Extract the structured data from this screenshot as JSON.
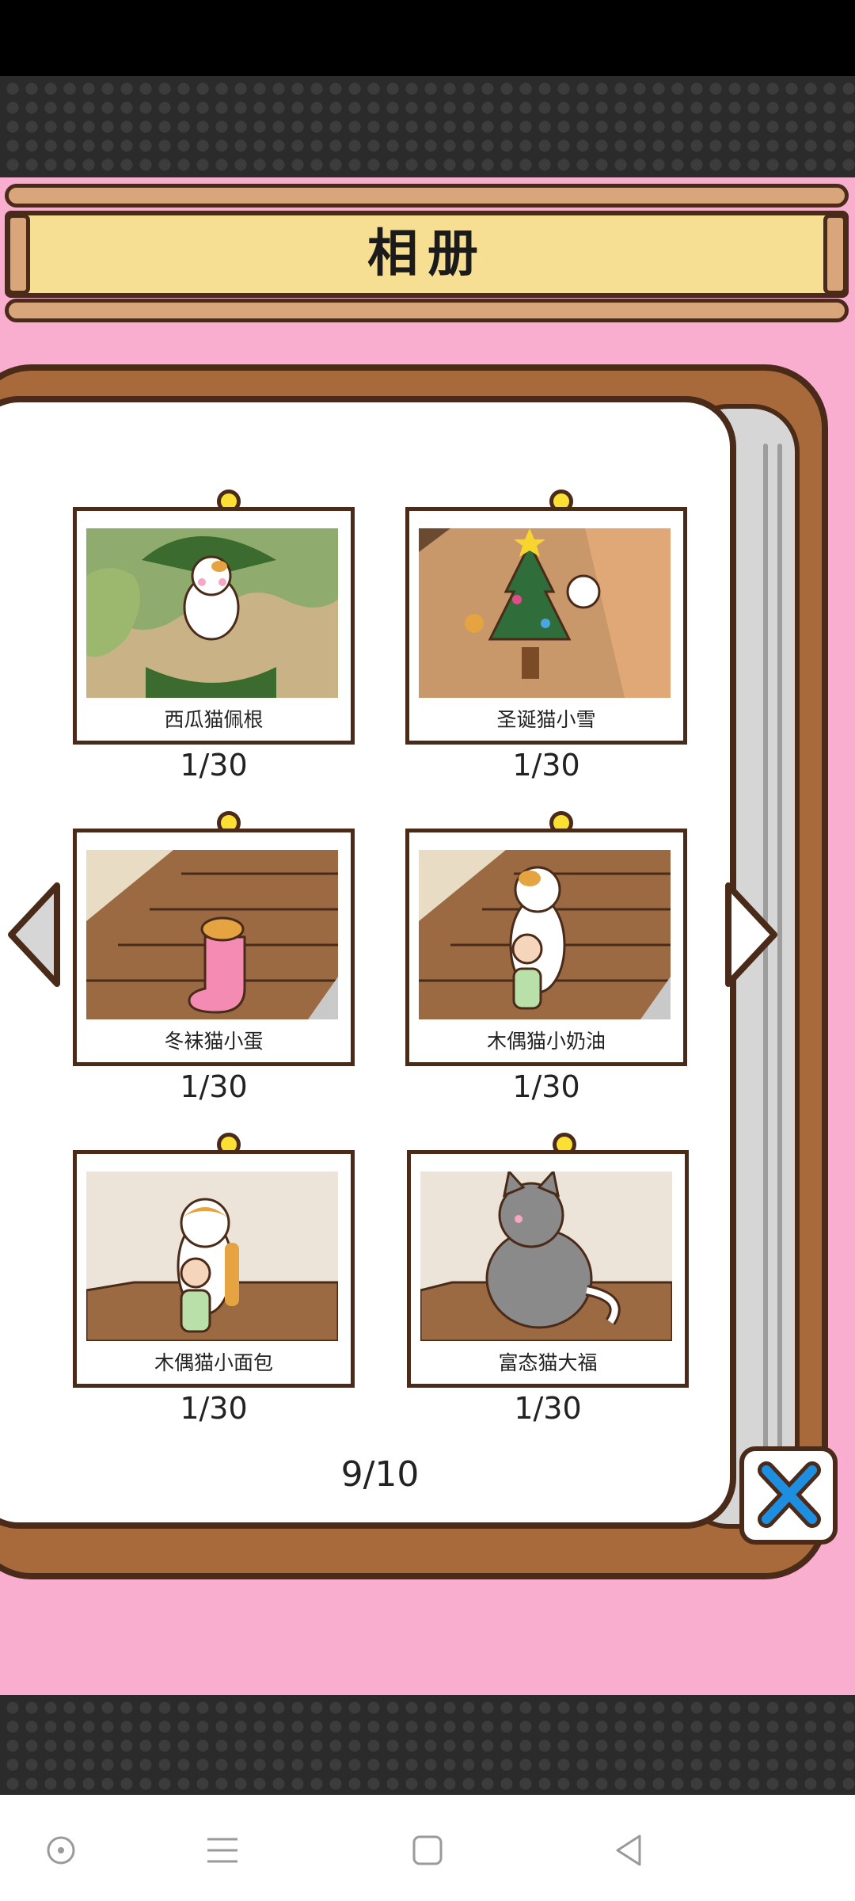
{
  "header": {
    "title": "相册"
  },
  "album": {
    "cards": [
      {
        "caption": "西瓜猫佩根",
        "count": "1/30"
      },
      {
        "caption": "圣诞猫小雪",
        "count": "1/30"
      },
      {
        "caption": "冬袜猫小蛋",
        "count": "1/30"
      },
      {
        "caption": "木偶猫小奶油",
        "count": "1/30"
      },
      {
        "caption": "木偶猫小面包",
        "count": "1/30"
      },
      {
        "caption": "富态猫大福",
        "count": "1/30"
      }
    ],
    "page_indicator": "9/10"
  },
  "colors": {
    "background_pink": "#f9adcf",
    "sign_yellow": "#f6de93",
    "wood": "#a86a3b",
    "outline": "#4a2a18",
    "close_blue": "#1e8fe0"
  },
  "icons": {
    "prev": "triangle-left-icon",
    "next": "triangle-right-icon",
    "close": "close-x-icon",
    "nav": [
      "circle-dot-icon",
      "menu-icon",
      "square-icon",
      "back-triangle-icon"
    ]
  }
}
